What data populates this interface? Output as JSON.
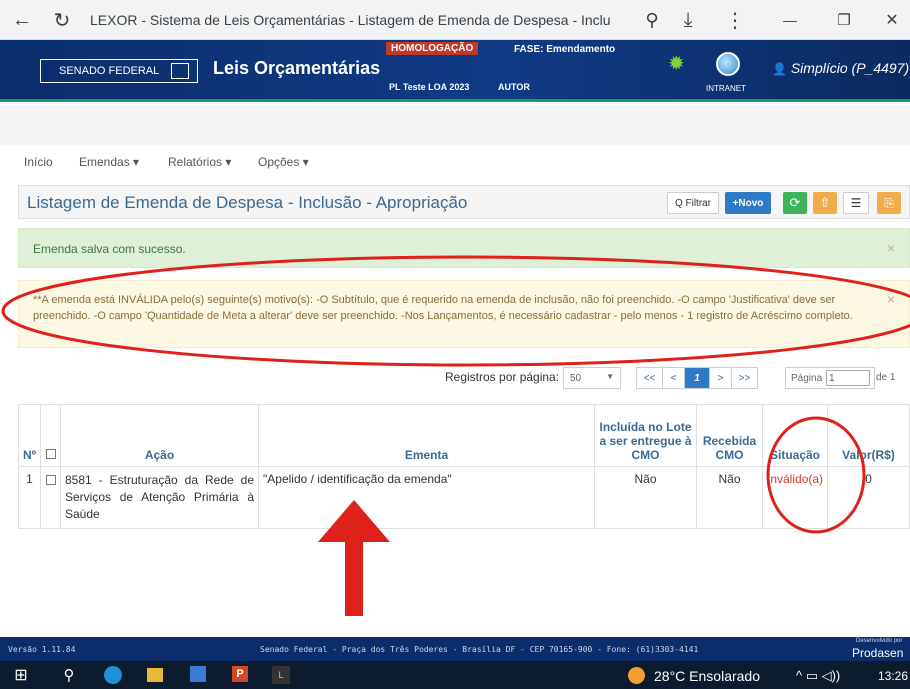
{
  "browser": {
    "title": "LEXOR - Sistema de Leis Orçamentárias - Listagem de Emenda de Despesa - Inclusã...",
    "back_glyph": "←",
    "reload_glyph": "↻",
    "zoom_glyph": "⚲",
    "download_glyph": "⤓",
    "menu_glyph": "⋮",
    "minimize_glyph": "—",
    "restore_glyph": "❐",
    "close_glyph": "✕"
  },
  "header": {
    "senado": "SENADO FEDERAL",
    "app_name": "Leis Orçamentárias",
    "env_badge": "HOMOLOGAÇÃO",
    "fase": "FASE: Emendamento",
    "pl": "PL Teste LOA 2023",
    "autor": "AUTOR",
    "intranet": "INTRANET",
    "user_name": "Simplício (P_4497)",
    "user_caret": "▾",
    "gear_glyph": "✹",
    "user_glyph": "👤",
    "accent_color": "#1a9a6c"
  },
  "nav": {
    "items": [
      {
        "label": "Início"
      },
      {
        "label": "Emendas ▾"
      },
      {
        "label": "Relatórios ▾"
      },
      {
        "label": "Opções ▾"
      }
    ]
  },
  "panel": {
    "title": "Listagem de Emenda de Despesa - Inclusão - Apropriação",
    "filter_label": "Q Filtrar",
    "new_label": "+Novo",
    "refresh_glyph": "⟳",
    "upload_glyph": "⇧",
    "list_glyph": "☰",
    "export_glyph": "⎘"
  },
  "alerts": {
    "success": "Emenda salva com sucesso.",
    "warning": "**A emenda está INVÁLIDA pelo(s) seguinte(s) motivo(s): -O Subtítulo, que é requerido na emenda de inclusão, não foi preenchido. -O campo 'Justificativa' deve ser preenchido. -O campo 'Quantidade de Meta a alterar' deve ser preenchido. -Nos Lançamentos, é necessário cadastrar - pelo menos - 1 registro de Acréscimo completo.",
    "close_glyph": "×"
  },
  "pager": {
    "per_page_label": "Registros por página:",
    "per_page_value": "50",
    "first": "<<",
    "prev": "<",
    "current": "1",
    "next": ">",
    "last": ">>",
    "page_label": "Página",
    "page_value": "1",
    "of_label": "de 1"
  },
  "table": {
    "headers": {
      "num": "Nº",
      "acao": "Ação",
      "ementa": "Ementa",
      "lote": "Incluída no Lote a ser entregue à CMO",
      "recebida": "Recebida CMO",
      "situacao": "Situação",
      "valor": "Valor(R$)"
    },
    "rows": [
      {
        "num": "1",
        "acao": "8581 - Estruturação da Rede de Serviços de Atenção Primária à Saúde",
        "ementa": "\"Apelido / identificação da emenda\"",
        "lote": "Não",
        "recebida": "Não",
        "situacao": "Inválido(a)",
        "valor": "0"
      }
    ],
    "invalid_color": "#d9342b"
  },
  "footer": {
    "version": "Versão 1.11.84",
    "address": "Senado Federal - Praça dos Três Poderes - Brasília DF - CEP 70165-900 - Fone: (61)3303-4141",
    "dev_by": "Desenvolvido por",
    "prodasen": "Prodasen"
  },
  "taskbar": {
    "weather": "28°C  Ensolarado",
    "tray": "^  ▭  ◁))",
    "time": "13:26",
    "start_glyph": "⊞",
    "search_glyph": "⚲"
  },
  "annotations": {
    "color": "#e0201a"
  }
}
